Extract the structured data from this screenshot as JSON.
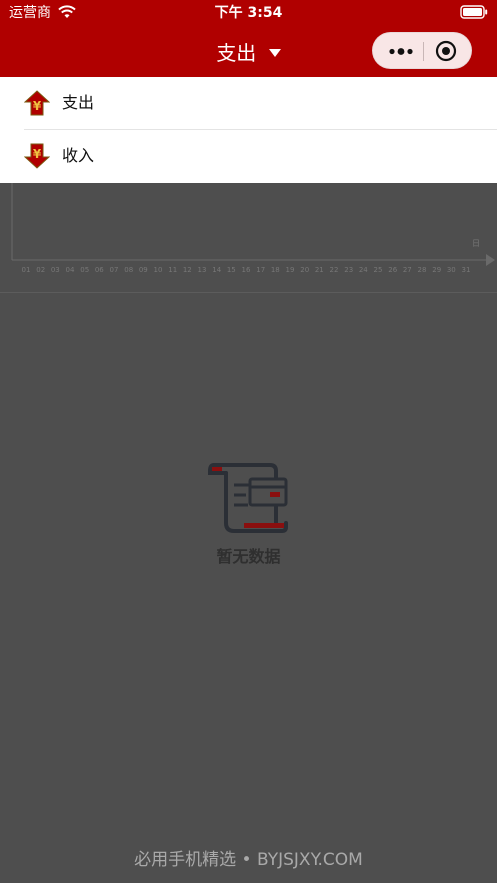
{
  "status_bar": {
    "carrier": "运营商",
    "time": "下午 3:54"
  },
  "nav": {
    "title": "支出"
  },
  "menu": {
    "items": [
      {
        "label": "支出",
        "icon": "yuan-arrow-up-icon"
      },
      {
        "label": "收入",
        "icon": "yuan-arrow-down-icon"
      }
    ]
  },
  "chart_data": {
    "type": "line",
    "x": [
      "01",
      "02",
      "03",
      "04",
      "05",
      "06",
      "07",
      "08",
      "09",
      "10",
      "11",
      "12",
      "13",
      "14",
      "15",
      "16",
      "17",
      "18",
      "19",
      "20",
      "21",
      "22",
      "23",
      "24",
      "25",
      "26",
      "27",
      "28",
      "29",
      "30",
      "31"
    ],
    "series": [],
    "axis_end_label": "日",
    "grid": false
  },
  "empty_state": {
    "text": "暂无数据",
    "icon": "empty-document-icon"
  },
  "watermark": {
    "text": "必用手机精选 • BYJSJXY.COM"
  },
  "colors": {
    "header_bg": "#b00000",
    "overlay": "#4e4e4e",
    "menu_bg": "#ffffff",
    "icon_red": "#b00000",
    "icon_gold": "#f0c040"
  }
}
